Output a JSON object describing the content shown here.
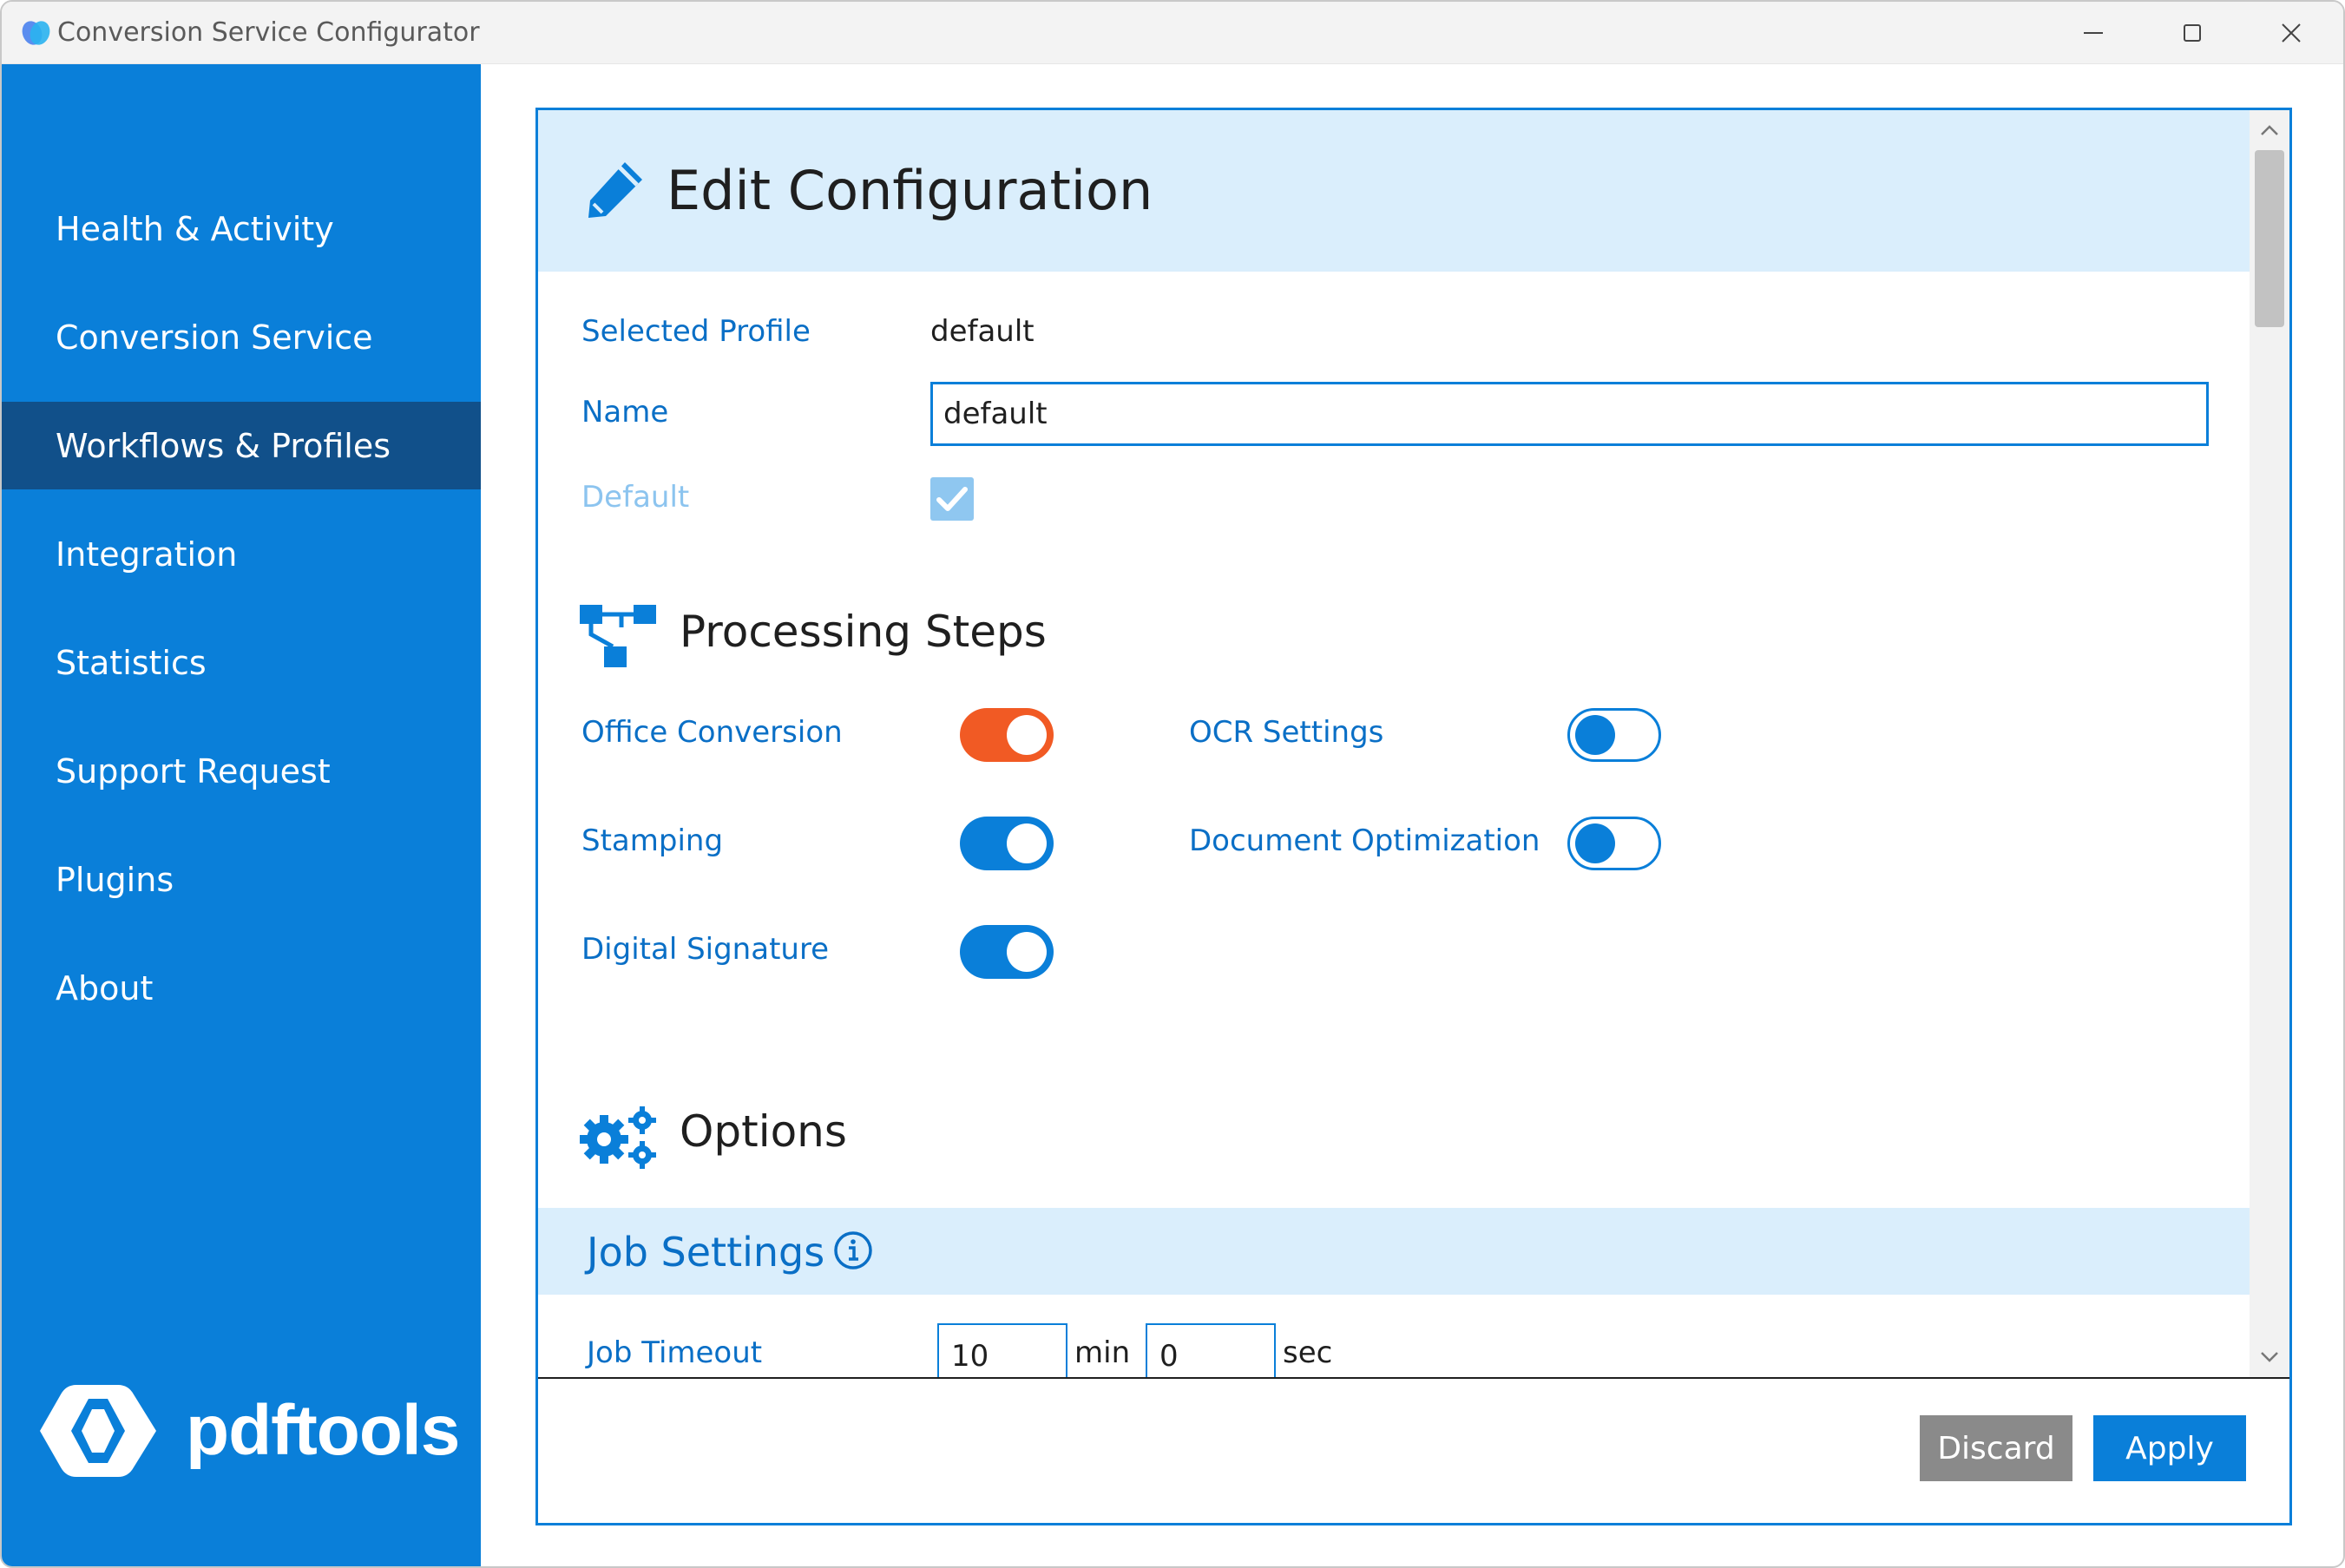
{
  "window": {
    "title": "Conversion Service Configurator"
  },
  "sidebar": {
    "items": [
      {
        "label": "Health & Activity",
        "active": false
      },
      {
        "label": "Conversion Service",
        "active": false
      },
      {
        "label": "Workflows & Profiles",
        "active": true
      },
      {
        "label": "Integration",
        "active": false
      },
      {
        "label": "Statistics",
        "active": false
      },
      {
        "label": "Support Request",
        "active": false
      },
      {
        "label": "Plugins",
        "active": false
      },
      {
        "label": "About",
        "active": false
      }
    ],
    "brand": "pdftools"
  },
  "edit": {
    "title": "Edit Configuration",
    "selected_profile_label": "Selected Profile",
    "selected_profile_value": "default",
    "name_label": "Name",
    "name_value": "default",
    "default_label": "Default",
    "default_checked": true
  },
  "processing": {
    "title": "Processing Steps",
    "steps": [
      {
        "label": "Office Conversion",
        "on": true,
        "color": "#f15a24"
      },
      {
        "label": "Stamping",
        "on": true,
        "color": "#0a7fd9"
      },
      {
        "label": "Digital Signature",
        "on": true,
        "color": "#0a7fd9"
      },
      {
        "label": "OCR Settings",
        "on": false,
        "color": "#0a7fd9"
      },
      {
        "label": "Document Optimization",
        "on": false,
        "color": "#0a7fd9"
      }
    ]
  },
  "options": {
    "title": "Options",
    "job_settings": {
      "title": "Job Settings",
      "job_timeout_label": "Job Timeout",
      "timeout_min": "10",
      "min_unit": "min",
      "timeout_sec": "0",
      "sec_unit": "sec"
    }
  },
  "footer": {
    "discard_label": "Discard",
    "apply_label": "Apply"
  },
  "colors": {
    "accent": "#0a7fd9",
    "sidebar_active": "#11508a",
    "header_band": "#daeefc",
    "toggle_orange": "#f15a24"
  },
  "icons": [
    "app-icon",
    "minimize-icon",
    "maximize-icon",
    "close-icon",
    "pencil-icon",
    "workflow-icon",
    "gears-icon",
    "info-icon",
    "check-icon",
    "chevron-up-icon",
    "chevron-down-icon",
    "pdftools-logo-icon"
  ]
}
